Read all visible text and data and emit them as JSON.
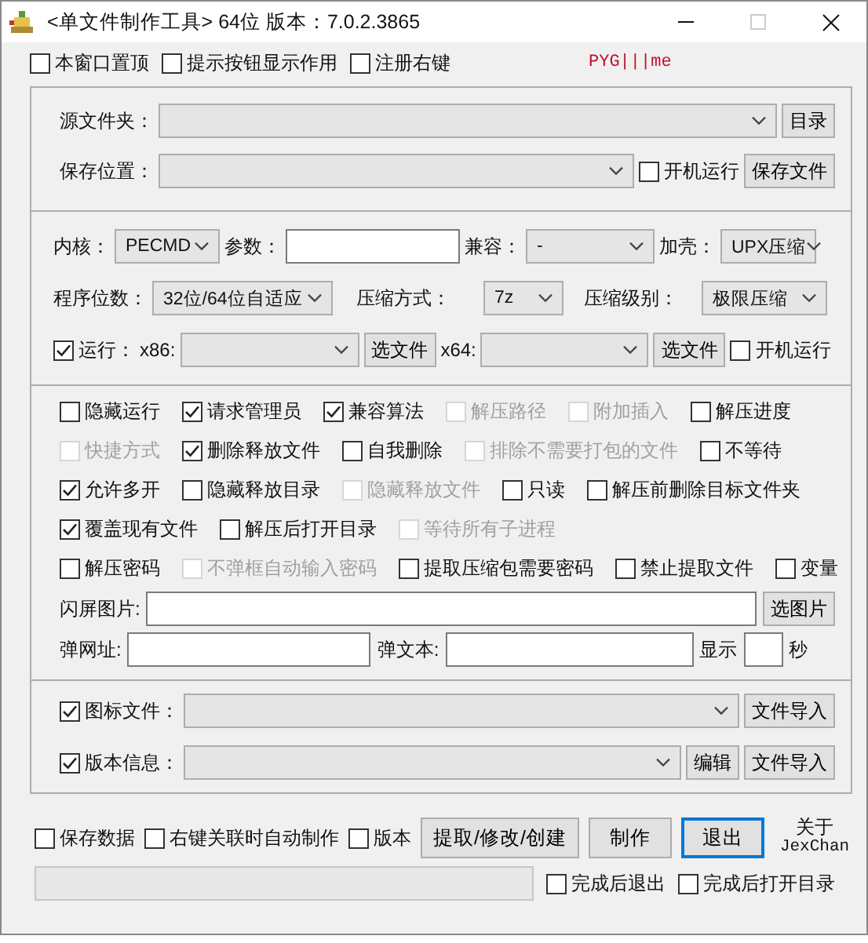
{
  "window": {
    "title": "<单文件制作工具> 64位 版本：7.0.2.3865"
  },
  "options": [
    {
      "label": "本窗口置顶",
      "checked": false
    },
    {
      "label": "提示按钮显示作用",
      "checked": false
    },
    {
      "label": "注册右键",
      "checked": false
    }
  ],
  "brand": "PYG|||me",
  "sections": [
    {
      "lines": [
        {
          "items": [
            {
              "kind": "label",
              "text": "源文件夹："
            },
            {
              "kind": "combo"
            },
            {
              "kind": "button",
              "text": "目录"
            }
          ]
        },
        {
          "items": [
            {
              "kind": "label",
              "text": "保存位置："
            },
            {
              "kind": "combo"
            },
            {
              "kind": "checkbox",
              "text": "开机运行",
              "checked": false,
              "disabled": false
            },
            {
              "kind": "button",
              "text": "保存文件"
            }
          ]
        }
      ]
    },
    {
      "lines": [
        {
          "items": [
            {
              "kind": "label",
              "text": "内核："
            },
            {
              "kind": "combo",
              "value": "PECMD"
            },
            {
              "kind": "label",
              "text": "参数："
            },
            {
              "kind": "field"
            },
            {
              "kind": "label",
              "text": "兼容："
            },
            {
              "kind": "combo",
              "value": "-"
            },
            {
              "kind": "label",
              "text": "加壳："
            },
            {
              "kind": "combo",
              "value": "UPX压缩"
            }
          ]
        },
        {
          "items": [
            {
              "kind": "label",
              "text": "程序位数："
            },
            {
              "kind": "combo",
              "value": "32位/64位自适应"
            },
            {
              "kind": "label",
              "text": "压缩方式："
            },
            {
              "kind": "combo",
              "value": "7z"
            },
            {
              "kind": "label",
              "text": "压缩级别："
            },
            {
              "kind": "combo",
              "value": "极限压缩"
            }
          ]
        },
        {
          "items": [
            {
              "kind": "checkbox",
              "text": "运行：",
              "checked": true,
              "disabled": false
            },
            {
              "kind": "label",
              "text": "x86:"
            },
            {
              "kind": "combo"
            },
            {
              "kind": "button",
              "text": "选文件"
            },
            {
              "kind": "label",
              "text": "x64:"
            },
            {
              "kind": "combo"
            },
            {
              "kind": "button",
              "text": "选文件"
            },
            {
              "kind": "checkbox",
              "text": "开机运行",
              "checked": false,
              "disabled": false
            }
          ]
        }
      ]
    },
    {
      "lines": [
        {
          "items": [
            {
              "kind": "checkbox",
              "text": "隐藏运行",
              "checked": false,
              "disabled": false
            },
            {
              "kind": "checkbox",
              "text": "请求管理员",
              "checked": true,
              "disabled": false
            },
            {
              "kind": "checkbox",
              "text": "兼容算法",
              "checked": true,
              "disabled": false
            },
            {
              "kind": "checkbox",
              "text": "解压路径",
              "checked": false,
              "disabled": true
            },
            {
              "kind": "checkbox",
              "text": "附加插入",
              "checked": false,
              "disabled": true
            },
            {
              "kind": "checkbox",
              "text": "解压进度",
              "checked": false,
              "disabled": false
            }
          ]
        },
        {
          "items": [
            {
              "kind": "checkbox",
              "text": "快捷方式",
              "checked": false,
              "disabled": true
            },
            {
              "kind": "checkbox",
              "text": "删除释放文件",
              "checked": true,
              "disabled": false
            },
            {
              "kind": "checkbox",
              "text": "自我删除",
              "checked": false,
              "disabled": false
            },
            {
              "kind": "checkbox",
              "text": "排除不需要打包的文件",
              "checked": false,
              "disabled": true
            },
            {
              "kind": "checkbox",
              "text": "不等待",
              "checked": false,
              "disabled": false
            }
          ]
        },
        {
          "items": [
            {
              "kind": "checkbox",
              "text": "允许多开",
              "checked": true,
              "disabled": false
            },
            {
              "kind": "checkbox",
              "text": "隐藏释放目录",
              "checked": false,
              "disabled": false
            },
            {
              "kind": "checkbox",
              "text": "隐藏释放文件",
              "checked": false,
              "disabled": true
            },
            {
              "kind": "checkbox",
              "text": "只读",
              "checked": false,
              "disabled": false
            },
            {
              "kind": "checkbox",
              "text": "解压前删除目标文件夹",
              "checked": false,
              "disabled": false
            }
          ]
        },
        {
          "items": [
            {
              "kind": "checkbox",
              "text": "覆盖现有文件",
              "checked": true,
              "disabled": false
            },
            {
              "kind": "checkbox",
              "text": "解压后打开目录",
              "checked": false,
              "disabled": false
            },
            {
              "kind": "checkbox",
              "text": "等待所有子进程",
              "checked": false,
              "disabled": true
            }
          ]
        },
        {
          "items": [
            {
              "kind": "checkbox",
              "text": "解压密码",
              "checked": false,
              "disabled": false
            },
            {
              "kind": "checkbox",
              "text": "不弹框自动输入密码",
              "checked": false,
              "disabled": true
            },
            {
              "kind": "checkbox",
              "text": "提取压缩包需要密码",
              "checked": false,
              "disabled": false
            },
            {
              "kind": "checkbox",
              "text": "禁止提取文件",
              "checked": false,
              "disabled": false
            },
            {
              "kind": "checkbox",
              "text": "变量",
              "checked": false,
              "disabled": false
            }
          ]
        },
        {
          "items": [
            {
              "kind": "label",
              "text": "闪屏图片:"
            },
            {
              "kind": "field"
            },
            {
              "kind": "button",
              "text": "选图片"
            }
          ]
        },
        {
          "items": [
            {
              "kind": "label",
              "text": "弹网址:"
            },
            {
              "kind": "field"
            },
            {
              "kind": "label",
              "text": "弹文本:"
            },
            {
              "kind": "field"
            },
            {
              "kind": "label",
              "text": "显示"
            },
            {
              "kind": "field"
            },
            {
              "kind": "label",
              "text": "秒"
            }
          ]
        }
      ]
    },
    {
      "lines": [
        {
          "items": [
            {
              "kind": "checkbox",
              "text": "图标文件：",
              "checked": true,
              "disabled": false
            },
            {
              "kind": "combo"
            },
            {
              "kind": "button",
              "text": "文件导入"
            }
          ]
        },
        {
          "items": [
            {
              "kind": "checkbox",
              "text": "版本信息：",
              "checked": true,
              "disabled": false
            },
            {
              "kind": "combo"
            },
            {
              "kind": "button",
              "text": "编辑"
            },
            {
              "kind": "button",
              "text": "文件导入"
            }
          ]
        }
      ]
    }
  ],
  "footer": {
    "checkboxes": [
      {
        "label": "保存数据",
        "checked": false
      },
      {
        "label": "右键关联时自动制作",
        "checked": false
      },
      {
        "label": "版本",
        "checked": false
      }
    ],
    "buttons": [
      {
        "label": "提取/修改/创建",
        "focused": false
      },
      {
        "label": "制作",
        "focused": false
      },
      {
        "label": "退出",
        "focused": true
      }
    ],
    "about": [
      "关于",
      "JexChan"
    ],
    "finish": [
      {
        "label": "完成后退出",
        "checked": false
      },
      {
        "label": "完成后打开目录",
        "checked": false
      }
    ]
  }
}
